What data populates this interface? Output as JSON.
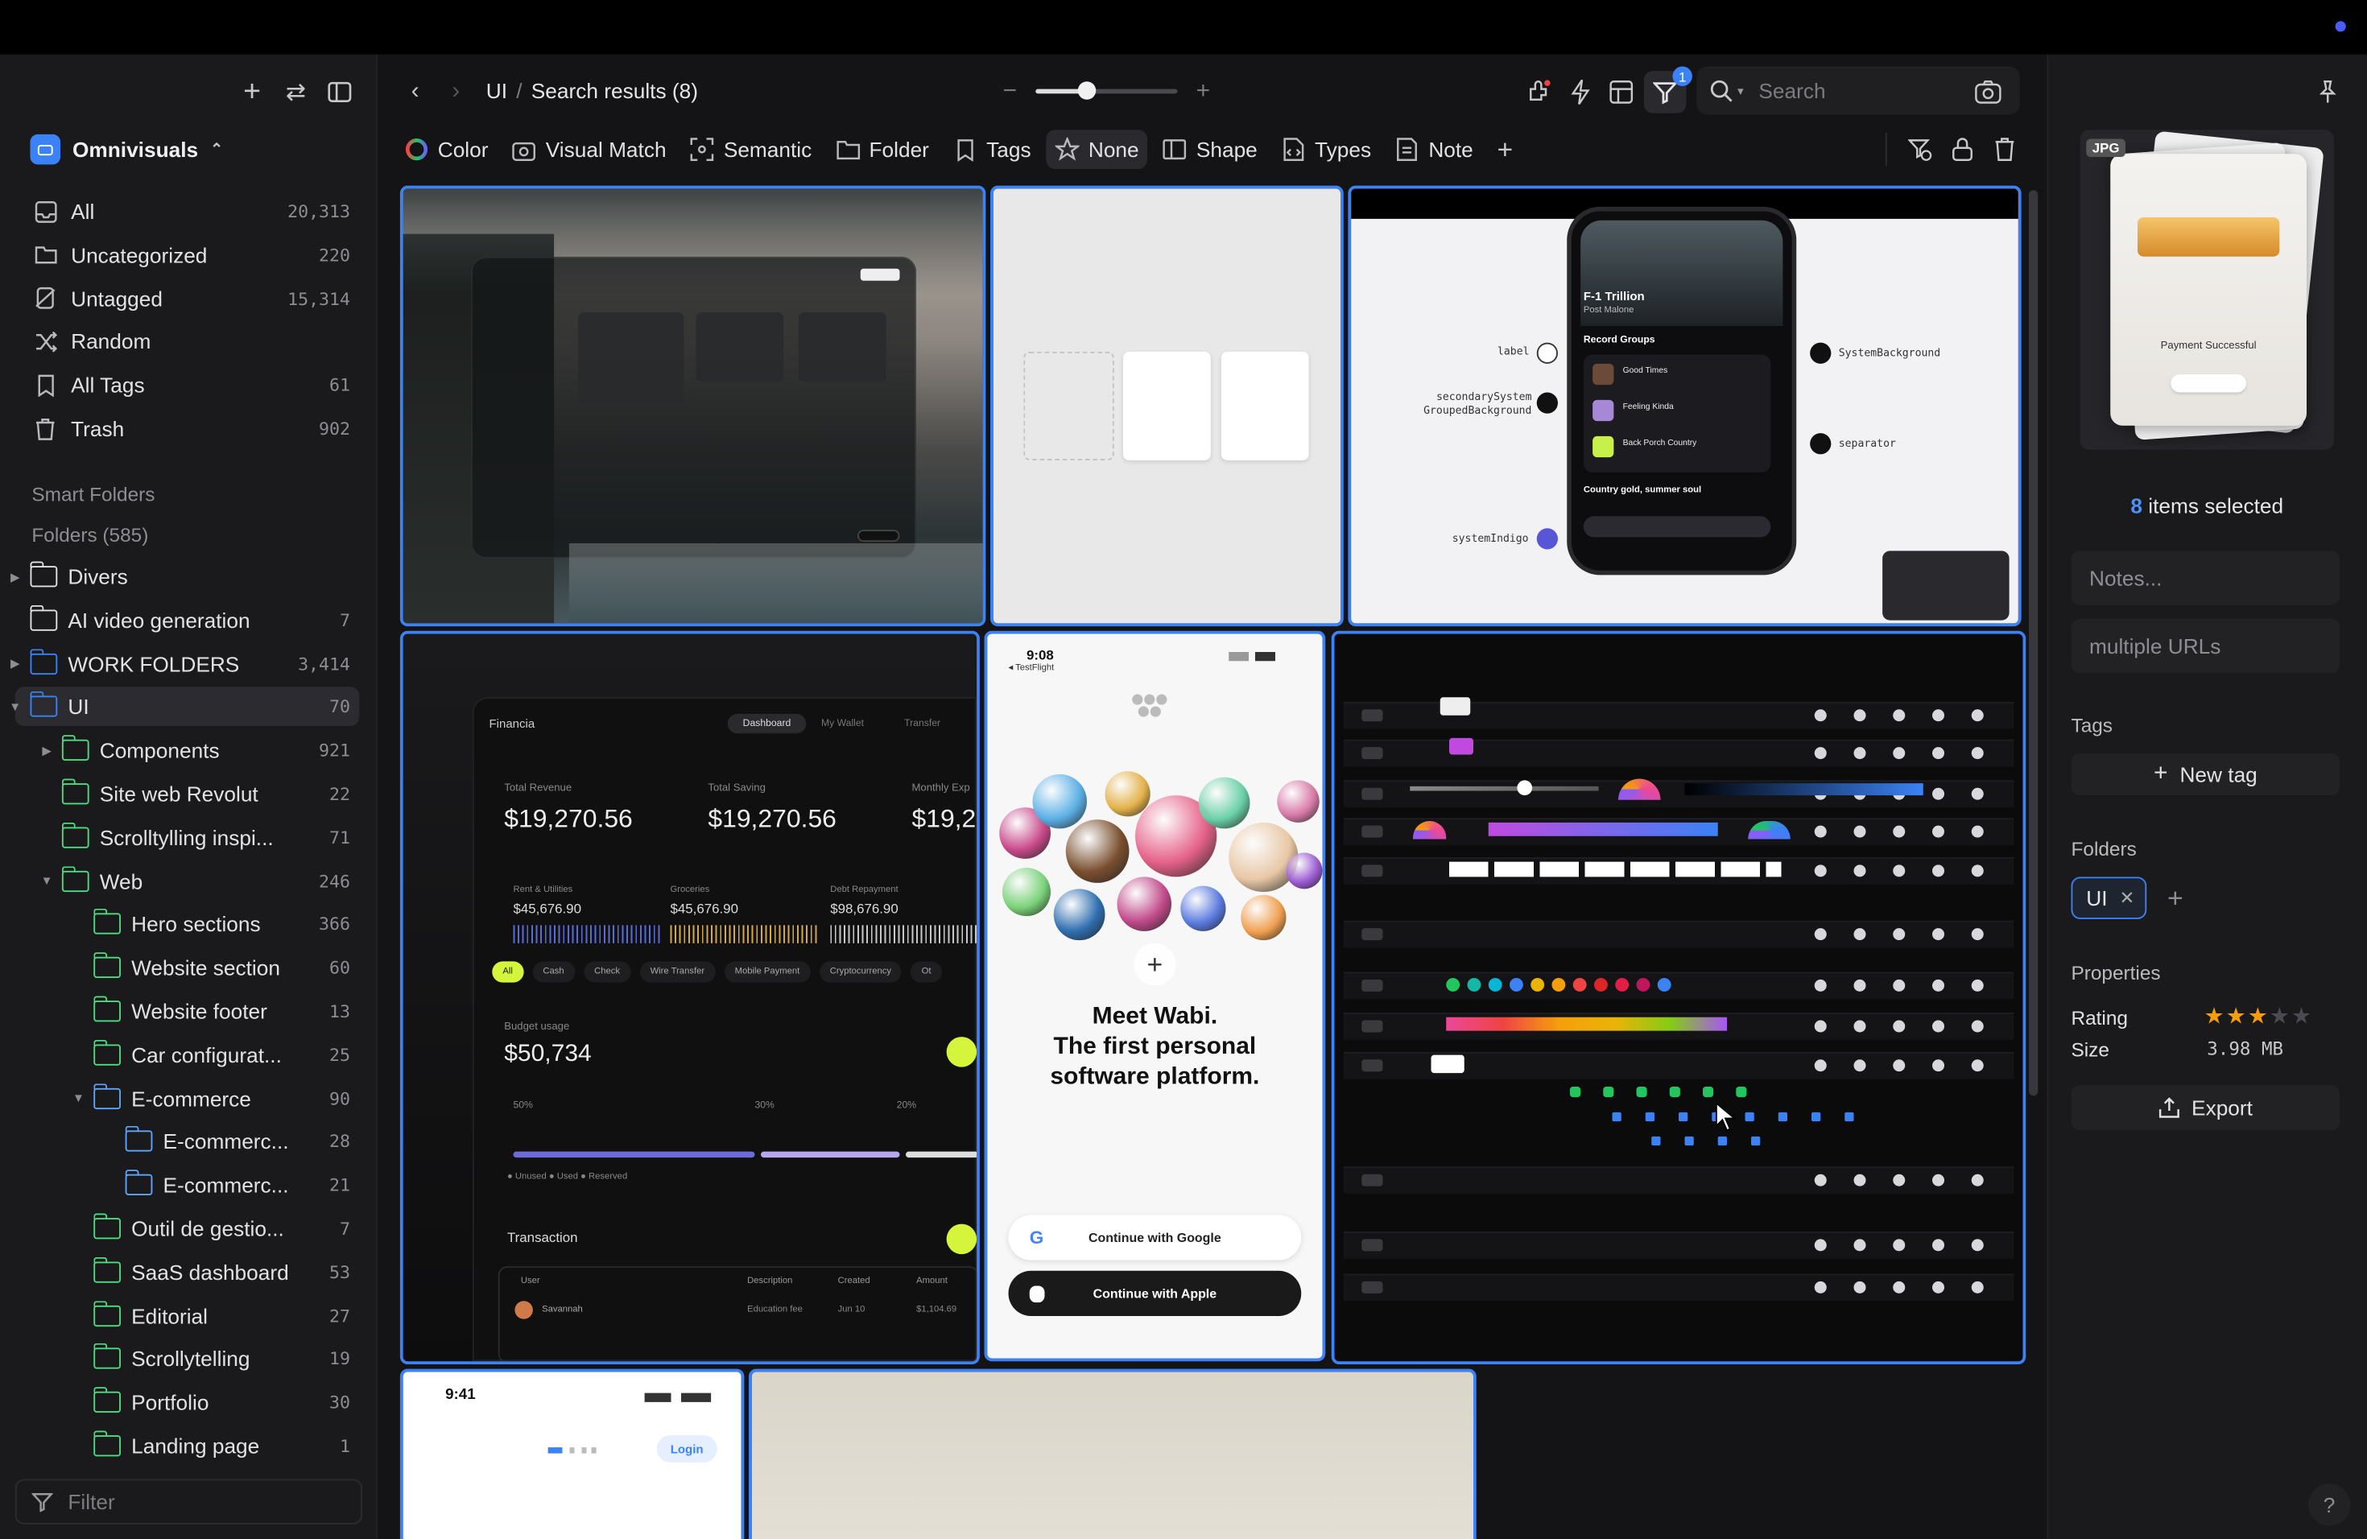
{
  "library": {
    "name": "Omnivisuals"
  },
  "nav": [
    {
      "label": "All",
      "count": "20,313",
      "icon": "inbox-icon"
    },
    {
      "label": "Uncategorized",
      "count": "220",
      "icon": "folder-question-icon"
    },
    {
      "label": "Untagged",
      "count": "15,314",
      "icon": "tag-off-icon"
    },
    {
      "label": "Random",
      "count": "",
      "icon": "shuffle-icon"
    },
    {
      "label": "All Tags",
      "count": "61",
      "icon": "bookmark-icon"
    },
    {
      "label": "Trash",
      "count": "902",
      "icon": "trash-icon"
    }
  ],
  "sections": {
    "smart_folders": "Smart Folders",
    "folders": "Folders (585)"
  },
  "folders": [
    {
      "label": "Divers",
      "count": "",
      "level": 0,
      "caret": "right",
      "color": "#e2e2e6"
    },
    {
      "label": "AI video generation",
      "count": "7",
      "level": 0,
      "caret": "",
      "color": "#e2e2e6"
    },
    {
      "label": "WORK FOLDERS",
      "count": "3,414",
      "level": 0,
      "caret": "right",
      "color": "#3b82f6"
    },
    {
      "label": "UI",
      "count": "70",
      "level": 0,
      "caret": "down",
      "color": "#3b82f6",
      "active": true
    },
    {
      "label": "Components",
      "count": "921",
      "level": 1,
      "caret": "right",
      "color": "#4ade80"
    },
    {
      "label": "Site web Revolut",
      "count": "22",
      "level": 1,
      "caret": "",
      "color": "#4ade80"
    },
    {
      "label": "Scrolltylling inspi...",
      "count": "71",
      "level": 1,
      "caret": "",
      "color": "#4ade80"
    },
    {
      "label": "Web",
      "count": "246",
      "level": 1,
      "caret": "down",
      "color": "#4ade80"
    },
    {
      "label": "Hero sections",
      "count": "366",
      "level": 2,
      "caret": "",
      "color": "#4ade80"
    },
    {
      "label": "Website section",
      "count": "60",
      "level": 2,
      "caret": "",
      "color": "#4ade80"
    },
    {
      "label": "Website footer",
      "count": "13",
      "level": 2,
      "caret": "",
      "color": "#4ade80"
    },
    {
      "label": "Car configurat...",
      "count": "25",
      "level": 2,
      "caret": "",
      "color": "#4ade80"
    },
    {
      "label": "E-commerce",
      "count": "90",
      "level": 2,
      "caret": "down",
      "color": "#60a5fa"
    },
    {
      "label": "E-commerc...",
      "count": "28",
      "level": 3,
      "caret": "",
      "color": "#60a5fa"
    },
    {
      "label": "E-commerc...",
      "count": "21",
      "level": 3,
      "caret": "",
      "color": "#60a5fa"
    },
    {
      "label": "Outil de gestio...",
      "count": "7",
      "level": 2,
      "caret": "",
      "color": "#4ade80"
    },
    {
      "label": "SaaS dashboard",
      "count": "53",
      "level": 2,
      "caret": "",
      "color": "#4ade80"
    },
    {
      "label": "Editorial",
      "count": "27",
      "level": 2,
      "caret": "",
      "color": "#4ade80"
    },
    {
      "label": "Scrollytelling",
      "count": "19",
      "level": 2,
      "caret": "",
      "color": "#4ade80"
    },
    {
      "label": "Portfolio",
      "count": "30",
      "level": 2,
      "caret": "",
      "color": "#4ade80"
    },
    {
      "label": "Landing page",
      "count": "1",
      "level": 2,
      "caret": "",
      "color": "#4ade80"
    }
  ],
  "filter": {
    "placeholder": "Filter"
  },
  "breadcrumb": {
    "parent": "UI",
    "current": "Search results (8)"
  },
  "zoom": {
    "level": 0.36
  },
  "search": {
    "placeholder": "Search"
  },
  "filter_badge": "1",
  "filter_chips": [
    {
      "label": "Color",
      "icon": "color-wheel-icon"
    },
    {
      "label": "Visual Match",
      "icon": "camera-search-icon"
    },
    {
      "label": "Semantic",
      "icon": "semantic-search-icon"
    },
    {
      "label": "Folder",
      "icon": "folder-icon"
    },
    {
      "label": "Tags",
      "icon": "bookmark-icon"
    },
    {
      "label": "None",
      "icon": "star-icon",
      "selected": true
    },
    {
      "label": "Shape",
      "icon": "shape-icon"
    },
    {
      "label": "Types",
      "icon": "file-code-icon"
    },
    {
      "label": "Note",
      "icon": "note-icon"
    }
  ],
  "thumbs": {
    "wabi": {
      "time": "9:08",
      "app": "◂ TestFlight",
      "title": "Meet Wabi.\nThe first personal\nsoftware platform.",
      "google": "Continue with Google",
      "apple": "Continue with Apple"
    },
    "finance": {
      "brand": "Financia",
      "tab1": "Dashboard",
      "tab2": "My Wallet",
      "tab3": "Transfer",
      "rev_label": "Total Revenue",
      "rev": "$19,270.56",
      "save_label": "Total Saving",
      "save": "$19,270.56",
      "exp_label": "Monthly Exp",
      "exp": "$19,2",
      "b1_label": "Rent & Utilities",
      "b1": "$45,676.90",
      "b2_label": "Groceries",
      "b2": "$45,676.90",
      "b3_label": "Debt Repayment",
      "b3": "$98,676.90",
      "chips": [
        "All",
        "Cash",
        "Check",
        "Wire Transfer",
        "Mobile Payment",
        "Cryptocurrency",
        "Ot"
      ],
      "budget_label": "Budget usage",
      "budget": "$50,734",
      "pct": [
        "50%",
        "30%",
        "20%"
      ],
      "legend": "● Unused  ● Used  ● Reserved",
      "tx": "Transaction",
      "cols": [
        "User",
        "Description",
        "Created",
        "Amount"
      ],
      "row1": [
        "Savannah",
        "Education fee",
        "Jun 10",
        "$1,104.69"
      ]
    },
    "phone": {
      "title": "F-1 Trillion",
      "sub": "Post Malone",
      "group": "Record Groups",
      "song1": "Good Times",
      "song2": "Feeling Kinda",
      "song3": "Back Porch Country",
      "np": "Country gold, summer soul",
      "labels": {
        "label": "label",
        "sec": "secondarySystem",
        "sec2": "GroupedBackground",
        "sys": "systemIndigo",
        "bg": "SystemBackground",
        "sepr": "separator"
      }
    },
    "login": {
      "time": "9:41",
      "button": "Login"
    }
  },
  "inspector": {
    "badge": "JPG",
    "card_text": "Payment Successful",
    "selected_count": "8",
    "selected_label": "items selected",
    "notes_placeholder": "Notes...",
    "urls_placeholder": "multiple URLs",
    "tags_title": "Tags",
    "new_tag": "New tag",
    "folders_title": "Folders",
    "folder_chip": "UI",
    "properties_title": "Properties",
    "rating_label": "Rating",
    "rating": 3,
    "rating_max": 5,
    "size_label": "Size",
    "size": "3.98 MB",
    "export": "Export"
  }
}
